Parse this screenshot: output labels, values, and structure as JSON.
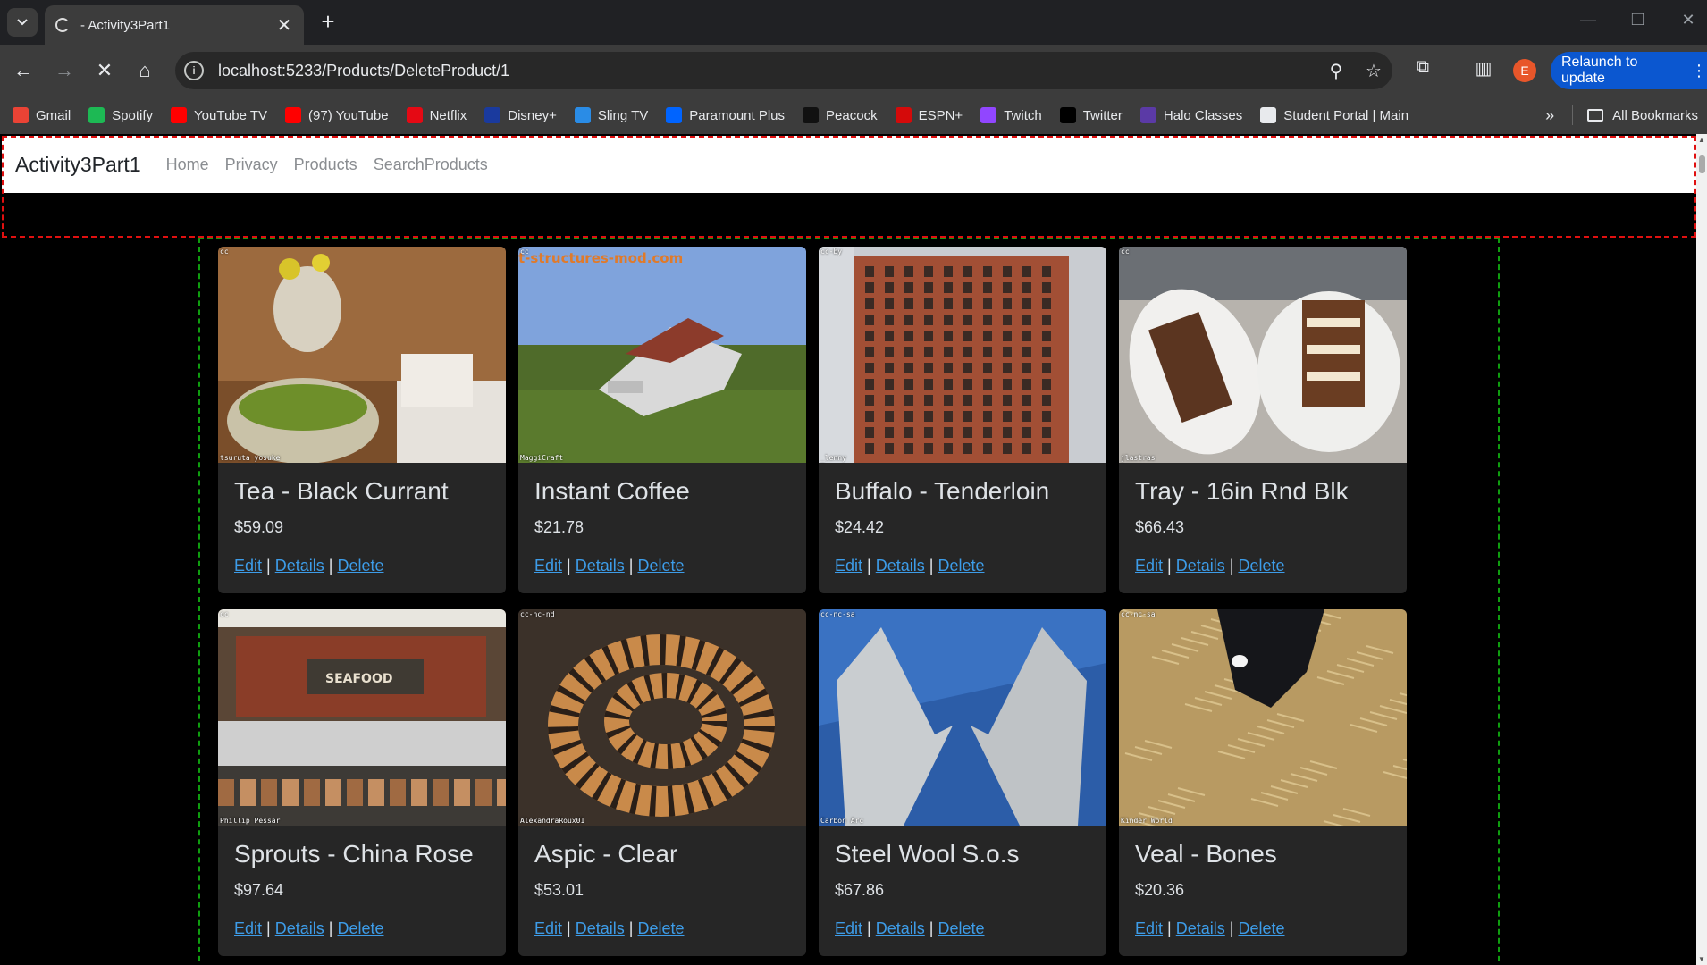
{
  "browser": {
    "tab_title": "- Activity3Part1",
    "url": "localhost:5233/Products/DeleteProduct/1",
    "profile_initial": "E",
    "relaunch_label": "Relaunch to update",
    "bookmarks": [
      {
        "label": "Gmail",
        "icon": "gmail-icon",
        "color": "#ea4335"
      },
      {
        "label": "Spotify",
        "icon": "spotify-icon",
        "color": "#1db954"
      },
      {
        "label": "YouTube TV",
        "icon": "youtube-tv-icon",
        "color": "#ff0000"
      },
      {
        "label": "(97) YouTube",
        "icon": "youtube-icon",
        "color": "#ff0000"
      },
      {
        "label": "Netflix",
        "icon": "netflix-icon",
        "color": "#e50914"
      },
      {
        "label": "Disney+",
        "icon": "disney-icon",
        "color": "#1a3a9e"
      },
      {
        "label": "Sling TV",
        "icon": "sling-icon",
        "color": "#2a8ce6"
      },
      {
        "label": "Paramount Plus",
        "icon": "paramount-icon",
        "color": "#0064ff"
      },
      {
        "label": "Peacock",
        "icon": "peacock-icon",
        "color": "#111111"
      },
      {
        "label": "ESPN+",
        "icon": "espn-icon",
        "color": "#d50a0a"
      },
      {
        "label": "Twitch",
        "icon": "twitch-icon",
        "color": "#9146ff"
      },
      {
        "label": "Twitter",
        "icon": "x-icon",
        "color": "#000000"
      },
      {
        "label": "Halo Classes",
        "icon": "halo-icon",
        "color": "#5b3aa6"
      },
      {
        "label": "Student Portal | Main",
        "icon": "portal-icon",
        "color": "#e8eaed"
      }
    ],
    "all_bookmarks_label": "All Bookmarks"
  },
  "site": {
    "brand": "Activity3Part1",
    "nav": [
      "Home",
      "Privacy",
      "Products",
      "SearchProducts"
    ]
  },
  "links": {
    "edit": "Edit",
    "details": "Details",
    "delete": "Delete",
    "sep": "|"
  },
  "products": [
    {
      "name": "Tea - Black Currant",
      "price": "$59.09",
      "image_tag": "cc",
      "credit": "tsuruta yosuke",
      "image_kind": "tea"
    },
    {
      "name": "Instant Coffee",
      "price": "$21.78",
      "image_tag": "cc",
      "credit": "MaggiCraft",
      "image_kind": "minecraft",
      "image_overlay": "t-structures-mod.com"
    },
    {
      "name": "Buffalo - Tenderloin",
      "price": "$24.42",
      "image_tag": "cc-by",
      "credit": "_lenny",
      "image_kind": "building"
    },
    {
      "name": "Tray - 16in Rnd Blk",
      "price": "$66.43",
      "image_tag": "cc",
      "credit": "jlastras",
      "image_kind": "cake"
    },
    {
      "name": "Sprouts - China Rose",
      "price": "$97.64",
      "image_tag": "cc",
      "credit": "Phillip Pessar",
      "image_kind": "market"
    },
    {
      "name": "Aspic - Clear",
      "price": "$53.01",
      "image_tag": "cc-nc-nd",
      "credit": "AlexandraRoux01",
      "image_kind": "snake"
    },
    {
      "name": "Steel Wool S.o.s",
      "price": "$67.86",
      "image_tag": "cc-nc-sa",
      "credit": "Carbon Arc",
      "image_kind": "calipers"
    },
    {
      "name": "Veal - Bones",
      "price": "$20.36",
      "image_tag": "cc-nc-sa",
      "credit": "Kinder World",
      "image_kind": "calf"
    }
  ]
}
